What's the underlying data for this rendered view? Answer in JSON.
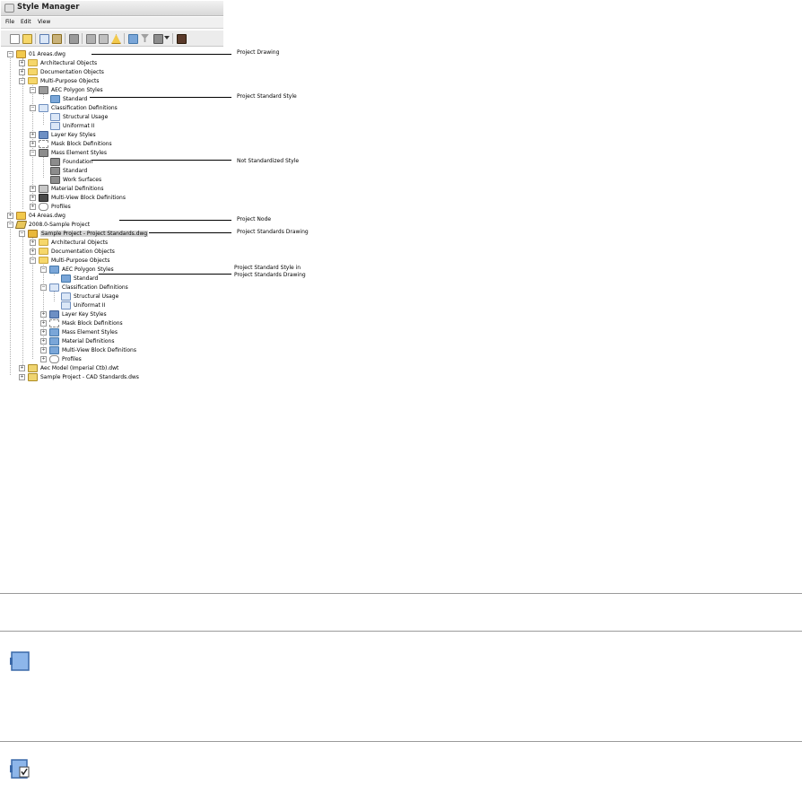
{
  "window": {
    "title": "Style Manager",
    "menu": [
      "File",
      "Edit",
      "View"
    ]
  },
  "toolbar_icons": [
    "new-icon",
    "open-icon",
    "copy-icon",
    "paste-icon",
    "edit-icon",
    "purge-icon",
    "import-icon",
    "warning-icon",
    "toggle-view-icon",
    "filter-icon",
    "display-icon",
    "settings-icon"
  ],
  "tree": {
    "n01": "01 Areas.dwg",
    "n02": "Architectural Objects",
    "n03": "Documentation Objects",
    "n04": "Multi-Purpose Objects",
    "n05": "AEC Polygon Styles",
    "n06": "Standard",
    "n07": "Classification Definitions",
    "n08": "Structural Usage",
    "n09": "Uniformat II",
    "n10": "Layer Key Styles",
    "n11": "Mask Block Definitions",
    "n12": "Mass Element Styles",
    "n13": "Foundation",
    "n14": "Standard",
    "n15": "Work Surfaces",
    "n16": "Material Definitions",
    "n17": "Multi-View Block Definitions",
    "n18": "Profiles",
    "n19": "04 Areas.dwg",
    "n20": "2008.0-Sample Project",
    "n21": "Sample Project - Project Standards.dwg",
    "n22": "Architectural Objects",
    "n23": "Documentation Objects",
    "n24": "Multi-Purpose Objects",
    "n25": "AEC Polygon Styles",
    "n26": "Standard",
    "n27": "Classification Definitions",
    "n28": "Structural Usage",
    "n29": "Uniformat II",
    "n30": "Layer Key Styles",
    "n31": "Mask Block Definitions",
    "n32": "Mass Element Styles",
    "n33": "Material Definitions",
    "n34": "Multi-View Block Definitions",
    "n35": "Profiles",
    "n36": "Aec Model (Imperial Ctb).dwt",
    "n37": "Sample Project - CAD Standards.dws"
  },
  "callouts": {
    "project_drawing": "Project Drawing",
    "project_standard_style": "Project Standard Style",
    "not_standardized_style": "Not Standardized Style",
    "project_node": "Project Node",
    "project_standards_drawing": "Project Standards Drawing",
    "project_standard_style_in_line1": "Project Standard Style in",
    "project_standard_style_in_line2": "Project Standards Drawing"
  },
  "legend_icons": [
    "standard-style-icon",
    "standard-style-checked-icon"
  ]
}
